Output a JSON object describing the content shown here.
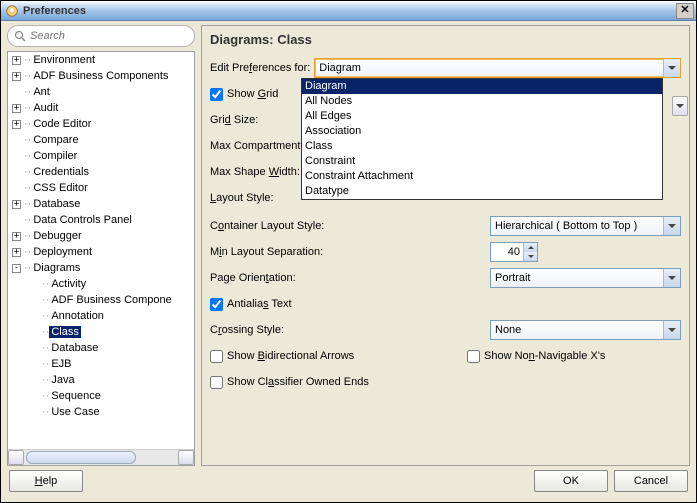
{
  "window": {
    "title": "Preferences"
  },
  "search": {
    "placeholder": "Search"
  },
  "tree": {
    "items": [
      {
        "l": "Environment",
        "d": 0,
        "e": "+"
      },
      {
        "l": "ADF Business Components",
        "d": 0,
        "e": "+"
      },
      {
        "l": "Ant",
        "d": 0,
        "e": ""
      },
      {
        "l": "Audit",
        "d": 0,
        "e": "+"
      },
      {
        "l": "Code Editor",
        "d": 0,
        "e": "+"
      },
      {
        "l": "Compare",
        "d": 0,
        "e": ""
      },
      {
        "l": "Compiler",
        "d": 0,
        "e": ""
      },
      {
        "l": "Credentials",
        "d": 0,
        "e": ""
      },
      {
        "l": "CSS Editor",
        "d": 0,
        "e": ""
      },
      {
        "l": "Database",
        "d": 0,
        "e": "+"
      },
      {
        "l": "Data Controls Panel",
        "d": 0,
        "e": ""
      },
      {
        "l": "Debugger",
        "d": 0,
        "e": "+"
      },
      {
        "l": "Deployment",
        "d": 0,
        "e": "+"
      },
      {
        "l": "Diagrams",
        "d": 0,
        "e": "-"
      },
      {
        "l": "Activity",
        "d": 1,
        "e": ""
      },
      {
        "l": "ADF Business Compone",
        "d": 1,
        "e": ""
      },
      {
        "l": "Annotation",
        "d": 1,
        "e": ""
      },
      {
        "l": "Class",
        "d": 1,
        "e": "",
        "sel": true
      },
      {
        "l": "Database",
        "d": 1,
        "e": ""
      },
      {
        "l": "EJB",
        "d": 1,
        "e": ""
      },
      {
        "l": "Java",
        "d": 1,
        "e": ""
      },
      {
        "l": "Sequence",
        "d": 1,
        "e": ""
      },
      {
        "l": "Use Case",
        "d": 1,
        "e": ""
      }
    ]
  },
  "page": {
    "title": "Diagrams: Class",
    "editPrefLabelPre": "Edit Pre",
    "editPrefLabelU": "f",
    "editPrefLabelPost": "erences for:",
    "editPrefValue": "Diagram",
    "showGridPre": "Show ",
    "showGridU": "G",
    "showGridPost": "rid",
    "gridSizePre": "Gri",
    "gridSizeU": "d",
    "gridSizePost": " Size:",
    "maxCompLabel": "Max Compartment En",
    "maxShapePre": "Max Shape ",
    "maxShapeU": "W",
    "maxShapePost": "idth:",
    "layoutStylePre": "",
    "layoutStyleU": "L",
    "layoutStylePost": "ayout Style:",
    "containerLayoutPre": "C",
    "containerLayoutU": "o",
    "containerLayoutPost": "ntainer Layout Style:",
    "containerLayoutValue": "Hierarchical ( Bottom to Top )",
    "minLayoutPre": "M",
    "minLayoutU": "i",
    "minLayoutPost": "n Layout Separation:",
    "minLayoutValue": "40",
    "pageOrientPre": "Page Orien",
    "pageOrientU": "t",
    "pageOrientPost": "ation:",
    "pageOrientValue": "Portrait",
    "antialiasPre": "Antialia",
    "antialiasU": "s",
    "antialiasPost": " Text",
    "crossingPre": "C",
    "crossingU": "r",
    "crossingPost": "ossing Style:",
    "crossingValue": "None",
    "bidirPre": "Show ",
    "bidirU": "B",
    "bidirPost": "idirectional Arrows",
    "nonNavPre": "Show No",
    "nonNavU": "n",
    "nonNavPost": "-Navigable X's",
    "classifierPre": "Show Cl",
    "classifierU": "a",
    "classifierPost": "ssifier Owned Ends"
  },
  "dropdown": {
    "items": [
      "Diagram",
      "All Nodes",
      "All Edges",
      "Association",
      "Class",
      "Constraint",
      "Constraint Attachment",
      "Datatype"
    ],
    "selected": 0
  },
  "footer": {
    "help": "Help",
    "helpU": "H",
    "helpPost": "elp",
    "ok": "OK",
    "cancel": "Cancel"
  }
}
